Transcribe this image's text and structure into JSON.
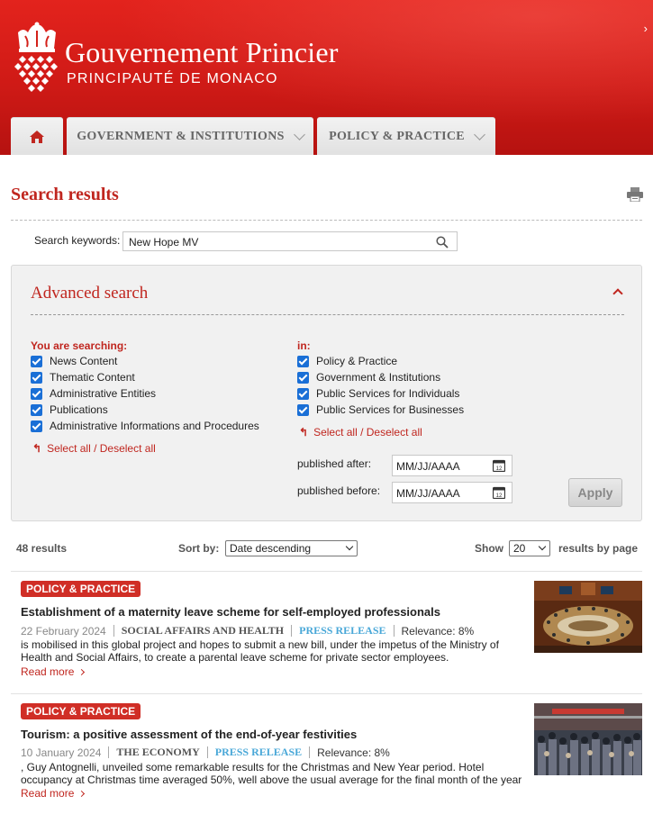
{
  "header": {
    "title": "Gouvernement Princier",
    "subtitle": "PRINCIPAUTÉ DE MONACO",
    "right_arrow": "›"
  },
  "nav": {
    "tabs": [
      {
        "label": "",
        "icon": "home-icon"
      },
      {
        "label": "GOVERNMENT & INSTITUTIONS"
      },
      {
        "label": "POLICY & PRACTICE"
      }
    ]
  },
  "page": {
    "title": "Search results"
  },
  "search": {
    "label": "Search keywords:",
    "value": "New Hope MV"
  },
  "advanced": {
    "title": "Advanced search",
    "left_label": "You are searching:",
    "left_items": [
      "News Content",
      "Thematic Content",
      "Administrative Entities",
      "Publications",
      "Administrative Informations and Procedures"
    ],
    "left_select": "Select all / Deselect all",
    "right_label": "in:",
    "right_items": [
      "Policy & Practice",
      "Government & Institutions",
      "Public Services for Individuals",
      "Public Services for Businesses"
    ],
    "right_select": "Select all / Deselect all",
    "published_after_label": "published after:",
    "published_after_placeholder": "MM/JJ/AAAA",
    "published_before_label": "published before:",
    "published_before_placeholder": "MM/JJ/AAAA",
    "apply_label": "Apply"
  },
  "results_bar": {
    "count": "48 results",
    "sort_label": "Sort by:",
    "sort_value": "Date descending",
    "show_label": "Show",
    "show_value": "20",
    "per_page_label": "results by page"
  },
  "results": [
    {
      "badge": "POLICY & PRACTICE",
      "title": "Establishment of a maternity leave scheme for self-employed professionals",
      "date": "22 February 2024",
      "category": "SOCIAL AFFAIRS AND HEALTH",
      "type": "PRESS RELEASE",
      "relevance": "Relevance: 8%",
      "excerpt": "is mobilised in this global project and hopes to submit a new bill, under the impetus of the Ministry of Health and Social Affairs, to create a parental leave scheme for private sector employees.",
      "read_more": "Read more"
    },
    {
      "badge": "POLICY & PRACTICE",
      "title": "Tourism: a positive assessment of the end-of-year festivities",
      "date": "10 January 2024",
      "category": "THE ECONOMY",
      "type": "PRESS RELEASE",
      "relevance": "Relevance: 8%",
      "excerpt": ", Guy Antognelli, unveiled some remarkable results for the Christmas and New Year period. Hotel occupancy at Christmas time averaged 50%, well above the usual average for the final month of the year",
      "read_more": "Read more"
    }
  ],
  "colors": {
    "brand_red": "#d02e26",
    "link_red": "#c0261f",
    "checkbox_blue": "#1a6fd6",
    "type_blue": "#4aa8d8"
  }
}
